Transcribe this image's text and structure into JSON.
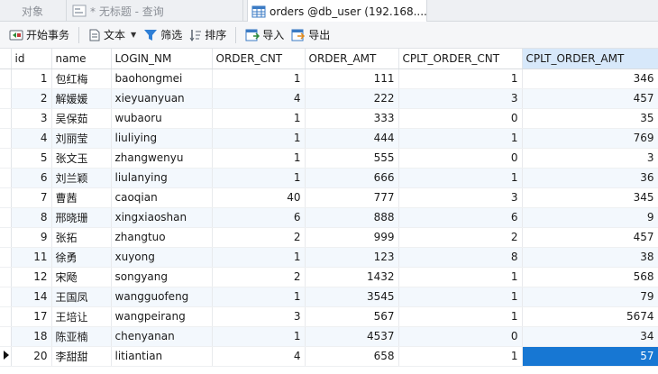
{
  "tabs": [
    {
      "label": "对象",
      "icon": "none"
    },
    {
      "label": "* 无标题 - 查询",
      "icon": "query-icon"
    },
    {
      "label": "orders @db_user (192.168....",
      "icon": "table-icon"
    }
  ],
  "toolbar": {
    "begin_transaction": "开始事务",
    "text": "文本",
    "filter": "筛选",
    "sort": "排序",
    "import": "导入",
    "export": "导出"
  },
  "grid": {
    "columns": [
      "id",
      "name",
      "LOGIN_NM",
      "ORDER_CNT",
      "ORDER_AMT",
      "CPLT_ORDER_CNT",
      "CPLT_ORDER_AMT"
    ],
    "selected_column": "CPLT_ORDER_AMT",
    "rows": [
      [
        "1",
        "包红梅",
        "baohongmei",
        "1",
        "111",
        "1",
        "346"
      ],
      [
        "2",
        "解媛媛",
        "xieyuanyuan",
        "4",
        "222",
        "3",
        "457"
      ],
      [
        "3",
        "吴保茹",
        "wubaoru",
        "1",
        "333",
        "0",
        "35"
      ],
      [
        "4",
        "刘丽莹",
        "liuliying",
        "1",
        "444",
        "1",
        "769"
      ],
      [
        "5",
        "张文玉",
        "zhangwenyu",
        "1",
        "555",
        "0",
        "3"
      ],
      [
        "6",
        "刘兰颖",
        "liulanying",
        "1",
        "666",
        "1",
        "36"
      ],
      [
        "7",
        "曹茜",
        "caoqian",
        "40",
        "777",
        "3",
        "345"
      ],
      [
        "8",
        "邢晓珊",
        "xingxiaoshan",
        "6",
        "888",
        "6",
        "9"
      ],
      [
        "9",
        "张拓",
        "zhangtuo",
        "2",
        "999",
        "2",
        "457"
      ],
      [
        "11",
        "徐勇",
        "xuyong",
        "1",
        "123",
        "8",
        "38"
      ],
      [
        "12",
        "宋飏",
        "songyang",
        "2",
        "1432",
        "1",
        "568"
      ],
      [
        "14",
        "王国凤",
        "wangguofeng",
        "1",
        "3545",
        "1",
        "79"
      ],
      [
        "17",
        "王培让",
        "wangpeirang",
        "3",
        "567",
        "1",
        "5674"
      ],
      [
        "18",
        "陈亚楠",
        "chenyanan",
        "1",
        "4537",
        "0",
        "34"
      ],
      [
        "20",
        "李甜甜",
        "litiantian",
        "4",
        "658",
        "1",
        "57"
      ]
    ],
    "current_row": 14
  },
  "colors": {
    "selection": "#1777d3",
    "header_selected": "#d7e8fa",
    "row_alt": "#f3f8fd"
  }
}
